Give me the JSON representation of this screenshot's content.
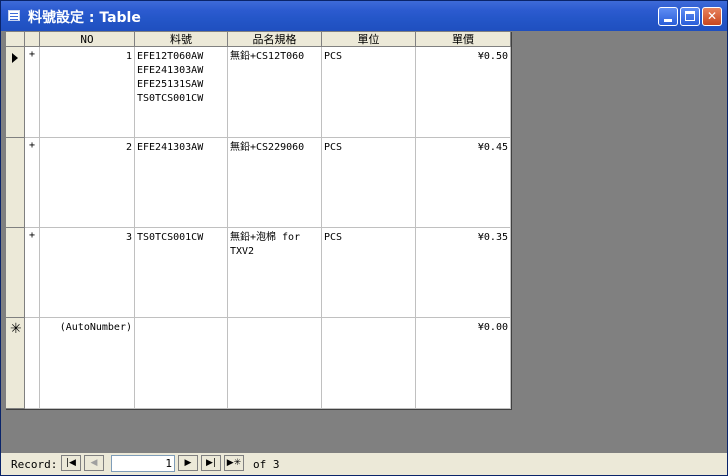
{
  "window": {
    "title": "料號設定 : Table"
  },
  "table": {
    "columns": [
      "NO",
      "料號",
      "品名規格",
      "單位",
      "單價"
    ],
    "rows": [
      {
        "expander": "+",
        "no": "1",
        "part": "EFE12T060AW\nEFE241303AW\nEFE25131SAW\nTS0TCS001CW",
        "desc": "無鉛+CS12T060",
        "unit": "PCS",
        "price": "¥0.50"
      },
      {
        "expander": "+",
        "no": "2",
        "part": "EFE241303AW",
        "desc": "無鉛+CS229060",
        "unit": "PCS",
        "price": "¥0.45"
      },
      {
        "expander": "+",
        "no": "3",
        "part": "TS0TCS001CW",
        "desc": "無鉛+泡棉 for\nTXV2",
        "unit": "PCS",
        "price": "¥0.35"
      }
    ],
    "new_row": {
      "no": "(AutoNumber)",
      "price": "¥0.00"
    }
  },
  "navigation": {
    "label": "Record:",
    "current": "1",
    "of_text": "of 3",
    "icons": [
      "first-record-icon",
      "prev-record-icon",
      "next-record-icon",
      "last-record-icon",
      "new-record-icon"
    ]
  }
}
